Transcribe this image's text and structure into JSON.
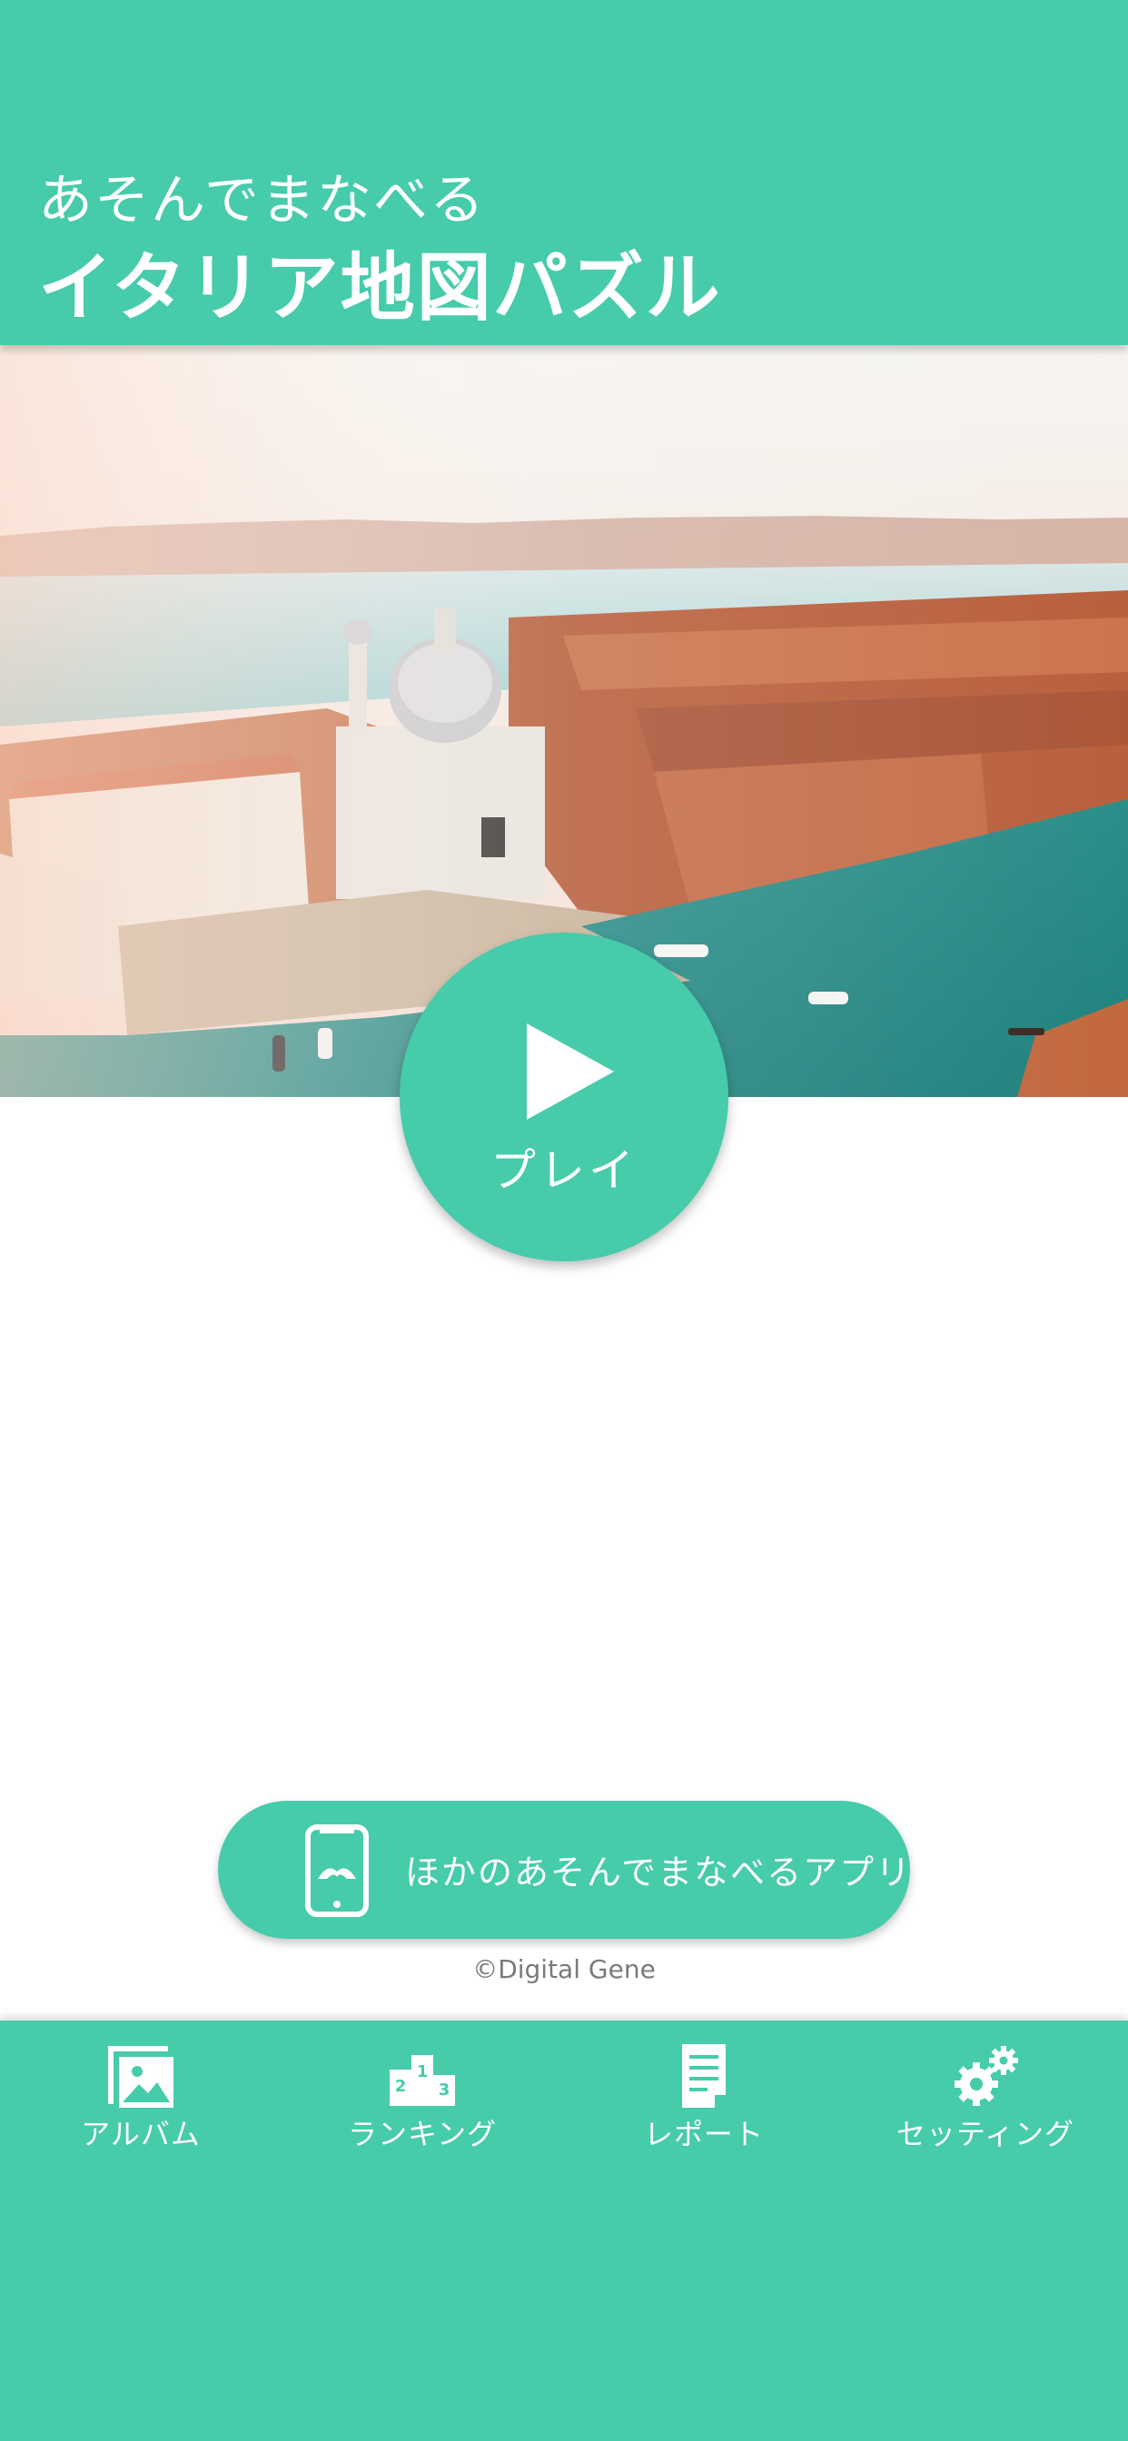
{
  "header": {
    "subtitle": "あそんでまなべる",
    "title": "イタリア地図パズル"
  },
  "hero": {
    "image": "venice-aerial-photo"
  },
  "play": {
    "label": "プレイ",
    "icon": "play-icon"
  },
  "apps_button": {
    "label": "ほかのあそんでまなべるアプリ",
    "icon": "smartphone-icon"
  },
  "copyright": "©Digital Gene",
  "tabbar": {
    "items": [
      {
        "label": "アルバム",
        "icon": "album-icon"
      },
      {
        "label": "ランキング",
        "icon": "podium-icon"
      },
      {
        "label": "レポート",
        "icon": "report-icon"
      },
      {
        "label": "セッティング",
        "icon": "gears-icon"
      }
    ]
  },
  "colors": {
    "accent": "#46cbab",
    "background": "#ffffff",
    "copyright_text": "#7a7a7a"
  }
}
